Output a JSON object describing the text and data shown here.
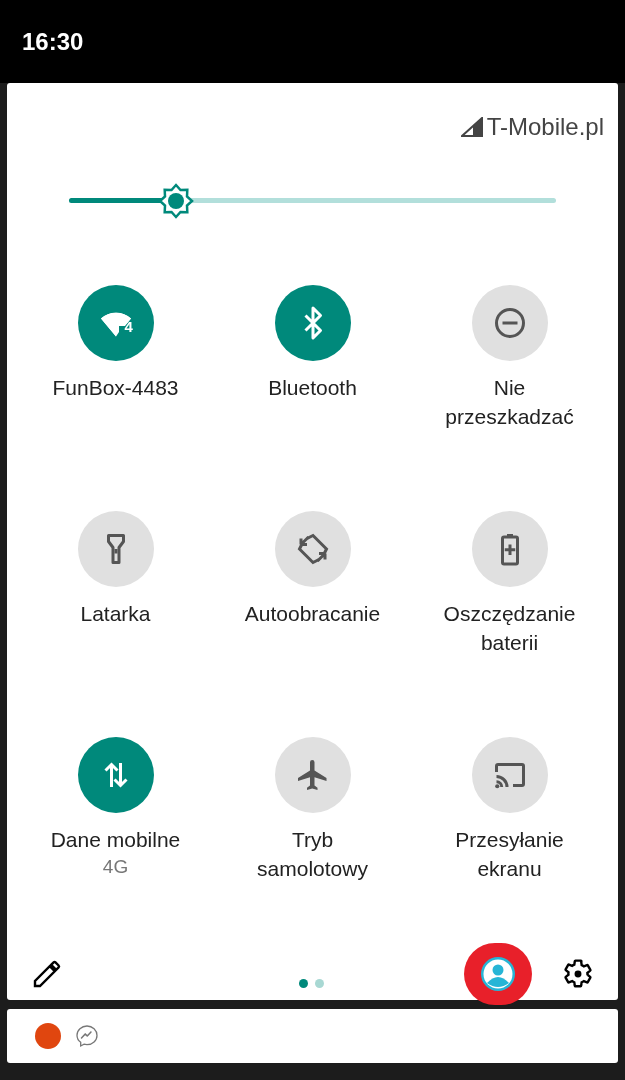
{
  "status_bar": {
    "time": "16:30"
  },
  "carrier": "T-Mobile.pl",
  "brightness": {
    "level": 0.22
  },
  "tiles": [
    {
      "label": "FunBox-4483",
      "on": true,
      "badge": "4"
    },
    {
      "label": "Bluetooth",
      "on": true
    },
    {
      "label": "Nie przeszkadzać",
      "on": false
    },
    {
      "label": "Latarka",
      "on": false
    },
    {
      "label": "Autoobracanie",
      "on": false
    },
    {
      "label": "Oszczędzanie baterii",
      "on": false
    },
    {
      "label": "Dane mobilne",
      "on": true,
      "sublabel": "4G"
    },
    {
      "label": "Tryb samolotowy",
      "on": false
    },
    {
      "label": "Przesyłanie ekranu",
      "on": false
    }
  ],
  "pages": [
    {
      "selected": true
    },
    {
      "selected": false
    }
  ],
  "user_highlighted": true
}
